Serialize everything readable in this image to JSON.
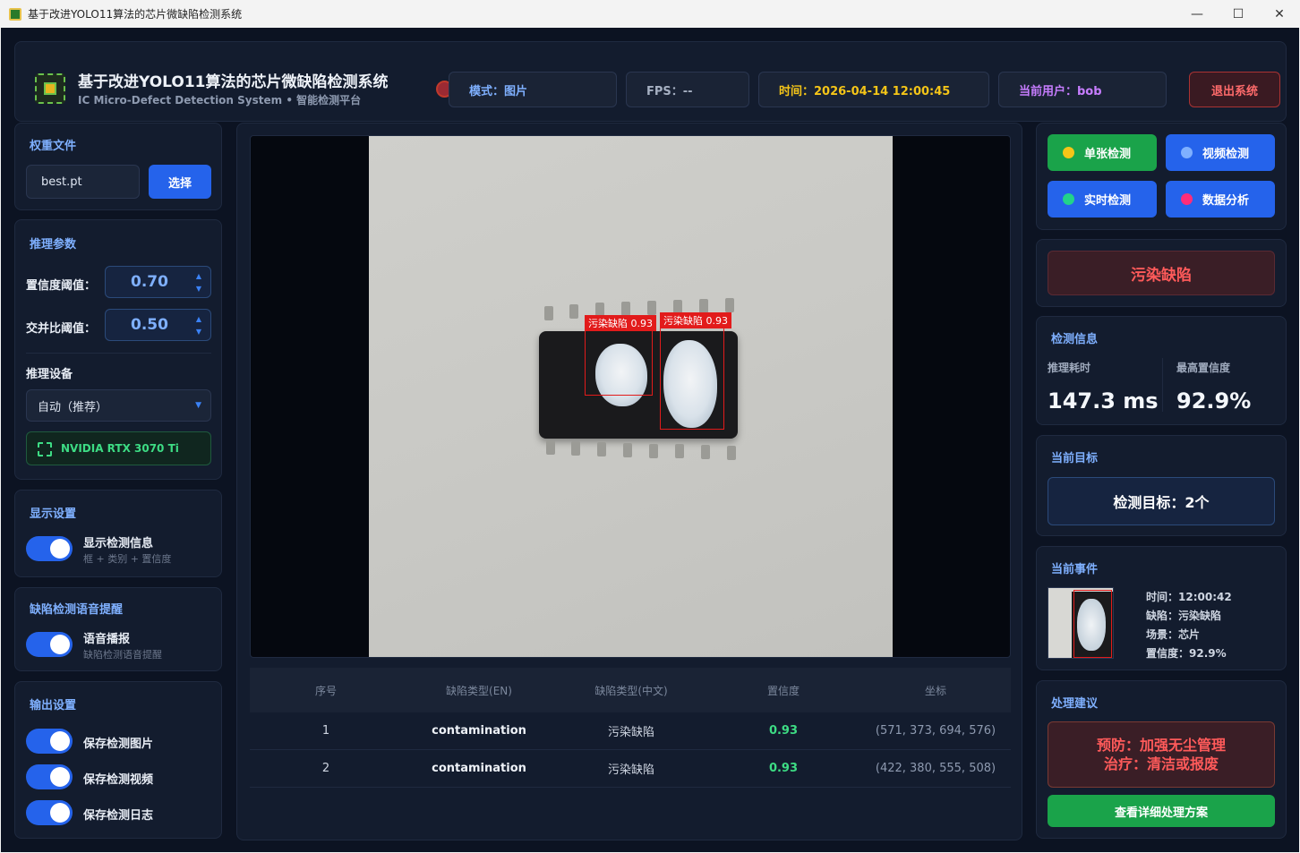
{
  "window": {
    "title": "基于改进YOLO11算法的芯片微缺陷检测系统",
    "minimize": "—",
    "maximize": "☐",
    "close": "✕"
  },
  "header": {
    "title": "基于改进YOLO11算法的芯片微缺陷检测系统",
    "subtitle": "IC Micro-Defect Detection System • 智能检测平台",
    "mode": "模式：图片",
    "fps": "FPS：--",
    "time": "时间：2026-04-14 12:00:45",
    "user": "当前用户：bob",
    "exit": "退出系统"
  },
  "weights": {
    "title": "权重文件",
    "file": "best.pt",
    "select": "选择"
  },
  "inference": {
    "title": "推理参数",
    "conf_label": "置信度阈值：",
    "conf_value": "0.70",
    "iou_label": "交并比阈值：",
    "iou_value": "0.50",
    "device_title": "推理设备",
    "device_select": "自动（推荐）",
    "gpu": "NVIDIA RTX 3070 Ti"
  },
  "display": {
    "title": "显示设置",
    "show_info": "显示检测信息",
    "show_info_sub": "框 + 类别 + 置信度"
  },
  "voice": {
    "title": "缺陷检测语音提醒",
    "label": "语音播报",
    "sub": "缺陷检测语音提醒"
  },
  "output": {
    "title": "输出设置",
    "save_image": "保存检测图片",
    "save_video": "保存检测视频",
    "save_log": "保存检测日志"
  },
  "viewer": {
    "detections": [
      {
        "label": "污染缺陷 0.93"
      },
      {
        "label": "污染缺陷 0.93"
      }
    ]
  },
  "table": {
    "headers": [
      "序号",
      "缺陷类型(EN)",
      "缺陷类型(中文)",
      "置信度",
      "坐标"
    ],
    "rows": [
      [
        "1",
        "contamination",
        "污染缺陷",
        "0.93",
        "(571, 373, 694, 576)"
      ],
      [
        "2",
        "contamination",
        "污染缺陷",
        "0.93",
        "(422, 380, 555, 508)"
      ]
    ]
  },
  "modes": {
    "single": "单张检测",
    "video": "视频检测",
    "realtime": "实时检测",
    "analysis": "数据分析"
  },
  "colors": {
    "single_dot": "#f5c518",
    "video_dot": "#7fb0ff",
    "realtime_dot": "#22d38a",
    "analysis_dot": "#ff2d7a",
    "accent": "#2563eb",
    "success": "#1aa34a",
    "danger": "#ff5a5a"
  },
  "defect_banner": "污染缺陷",
  "detect_info": {
    "title": "检测信息",
    "time_label": "推理耗时",
    "time_value": "147.3 ms",
    "conf_label": "最高置信度",
    "conf_value": "92.9%"
  },
  "current_target": {
    "title": "当前目标",
    "value": "检测目标：2个"
  },
  "current_event": {
    "title": "当前事件",
    "time": "时间：12:00:42",
    "defect": "缺陷：污染缺陷",
    "scene": "场景：芯片",
    "conf": "置信度：92.9%"
  },
  "advice": {
    "title": "处理建议",
    "prevent": "预防：加强无尘管理",
    "treat": "治疗：清洁或报废",
    "button": "查看详细处理方案"
  }
}
